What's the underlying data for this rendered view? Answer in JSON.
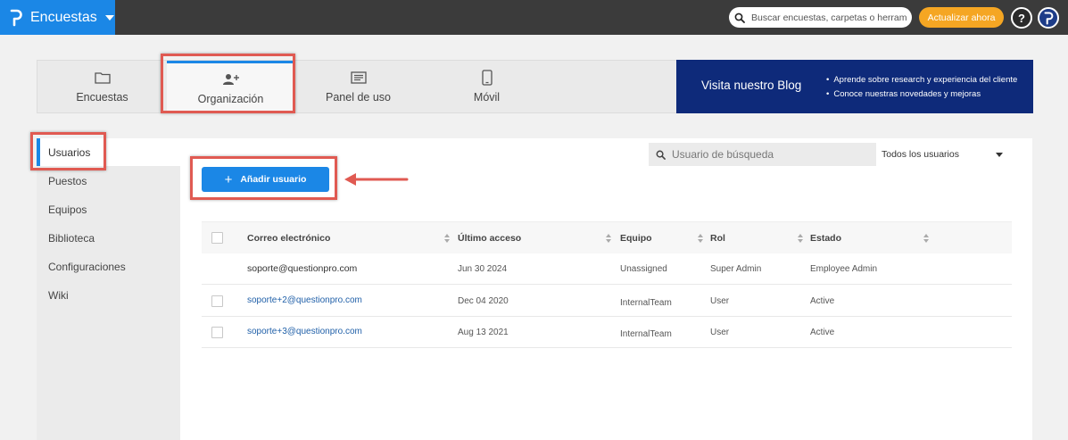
{
  "topbar": {
    "brand_label": "Encuestas",
    "search_placeholder": "Buscar encuestas, carpetas o herrami",
    "update_button": "Actualizar ahora",
    "help_label": "?",
    "accent": "#1b87e6",
    "bar_color": "#3b3b3b"
  },
  "tabs": [
    {
      "label": "Encuestas",
      "icon": "folder-icon"
    },
    {
      "label": "Organización",
      "icon": "user-add-icon",
      "active": true
    },
    {
      "label": "Panel de uso",
      "icon": "dashboard-icon"
    },
    {
      "label": "Móvil",
      "icon": "mobile-icon"
    }
  ],
  "blog": {
    "title": "Visita nuestro Blog",
    "bullets": [
      "Aprende sobre research y experiencia del cliente",
      "Conoce nuestras novedades y mejoras"
    ],
    "color": "#0e2a7a"
  },
  "sidebar": {
    "items": [
      {
        "label": "Usuarios",
        "active": true
      },
      {
        "label": "Puestos"
      },
      {
        "label": "Equipos"
      },
      {
        "label": "Biblioteca"
      },
      {
        "label": "Configuraciones"
      },
      {
        "label": "Wiki"
      }
    ]
  },
  "main": {
    "user_search_placeholder": "Usuario de búsqueda",
    "filter_value": "Todos los usuarios",
    "add_user_button": "Añadir usuario"
  },
  "table": {
    "columns": [
      "Correo electrónico",
      "Último acceso",
      "Equipo",
      "Rol",
      "Estado"
    ],
    "rows": [
      {
        "email": "soporte@questionpro.com",
        "last_access": "Jun 30 2024",
        "team": "Unassigned",
        "role": "Super Admin",
        "status": "Employee Admin",
        "selectable": false
      },
      {
        "email": "soporte+2@questionpro.com",
        "last_access": "Dec 04 2020",
        "team": "InternalTeam",
        "role": "User",
        "status": "Active",
        "selectable": true
      },
      {
        "email": "soporte+3@questionpro.com",
        "last_access": "Aug 13 2021",
        "team": "InternalTeam",
        "role": "User",
        "status": "Active",
        "selectable": true
      }
    ]
  },
  "annotation_color": "#e05a52"
}
